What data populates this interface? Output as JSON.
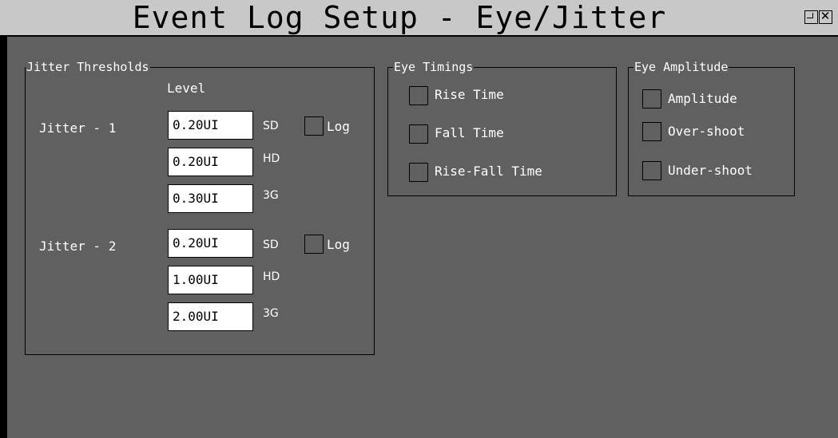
{
  "window": {
    "title": "Event Log Setup - Eye/Jitter",
    "restore_icon": "restore-window-icon",
    "close_icon": "close-window-icon",
    "close_glyph": "✕"
  },
  "jitter_thresholds": {
    "legend": "Jitter Thresholds",
    "level_header": "Level",
    "rows": [
      {
        "label": "Jitter - 1",
        "log_label": "Log",
        "log_checked": false,
        "levels": [
          {
            "value": "0.20UI",
            "standard": "SD"
          },
          {
            "value": "0.20UI",
            "standard": "HD"
          },
          {
            "value": "0.30UI",
            "standard": "3G"
          }
        ]
      },
      {
        "label": "Jitter - 2",
        "log_label": "Log",
        "log_checked": false,
        "levels": [
          {
            "value": "0.20UI",
            "standard": "SD"
          },
          {
            "value": "1.00UI",
            "standard": "HD"
          },
          {
            "value": "2.00UI",
            "standard": "3G"
          }
        ]
      }
    ]
  },
  "eye_timings": {
    "legend": "Eye Timings",
    "items": [
      {
        "label": "Rise Time",
        "checked": false
      },
      {
        "label": "Fall Time",
        "checked": false
      },
      {
        "label": "Rise-Fall Time",
        "checked": false
      }
    ]
  },
  "eye_amplitude": {
    "legend": "Eye Amplitude",
    "items": [
      {
        "label": "Amplitude",
        "checked": false
      },
      {
        "label": "Over-shoot",
        "checked": false
      },
      {
        "label": "Under-shoot",
        "checked": false
      }
    ]
  },
  "colors": {
    "background": "#606060",
    "titlebar": "#c8c8c8",
    "field": "#ffffff",
    "text": "#ffffff"
  }
}
